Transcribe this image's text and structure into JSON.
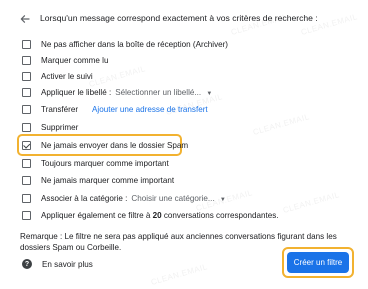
{
  "header": {
    "text": "Lorsqu'un message correspond exactement à vos critères de recherche :"
  },
  "options": [
    {
      "label": "Ne pas afficher dans la boîte de réception (Archiver)",
      "checked": false
    },
    {
      "label": "Marquer comme lu",
      "checked": false
    },
    {
      "label": "Activer le suivi",
      "checked": false
    },
    {
      "label": "Appliquer le libellé :",
      "checked": false,
      "select": "Sélectionner un libellé..."
    },
    {
      "label": "Transférer",
      "checked": false,
      "link": "Ajouter une adresse de transfert"
    },
    {
      "label": "Supprimer",
      "checked": false
    },
    {
      "label": "Ne jamais envoyer dans le dossier Spam",
      "checked": true
    },
    {
      "label": "Toujours marquer comme important",
      "checked": false
    },
    {
      "label": "Ne jamais marquer comme important",
      "checked": false
    },
    {
      "label": "Associer à la catégorie :",
      "checked": false,
      "select": "Choisir une catégorie..."
    },
    {
      "label_prefix": "Appliquer également ce filtre à ",
      "label_count": "20",
      "label_suffix": " conversations correspondantes.",
      "checked": false
    }
  ],
  "note": "Remarque : Le filtre ne sera pas appliqué aux anciennes conversations figurant dans les dossiers Spam ou Corbeille.",
  "help": {
    "label": "En savoir plus"
  },
  "create_button": {
    "label": "Créer un filtre"
  },
  "watermark": "CLEAN.EMAIL",
  "icons": {
    "back": "arrow-left-icon",
    "help": "help-circle-icon",
    "dropdown": "caret-down-icon"
  }
}
